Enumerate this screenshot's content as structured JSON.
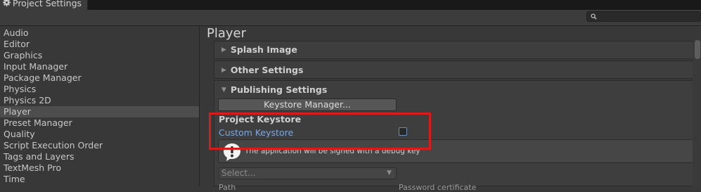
{
  "window": {
    "title": "Project Settings"
  },
  "search": {
    "placeholder": ""
  },
  "sidebar": {
    "items": [
      {
        "label": "Audio"
      },
      {
        "label": "Editor"
      },
      {
        "label": "Graphics"
      },
      {
        "label": "Input Manager"
      },
      {
        "label": "Package Manager"
      },
      {
        "label": "Physics"
      },
      {
        "label": "Physics 2D"
      },
      {
        "label": "Player"
      },
      {
        "label": "Preset Manager"
      },
      {
        "label": "Quality"
      },
      {
        "label": "Script Execution Order"
      },
      {
        "label": "Tags and Layers"
      },
      {
        "label": "TextMesh Pro"
      },
      {
        "label": "Time"
      }
    ],
    "selected": "Player"
  },
  "main": {
    "title": "Player",
    "foldouts": [
      {
        "label": "Splash Image",
        "expanded": false
      },
      {
        "label": "Other Settings",
        "expanded": false
      },
      {
        "label": "Publishing Settings",
        "expanded": true
      }
    ],
    "keystore_manager_button": "Keystore Manager...",
    "project_keystore_label": "Project Keystore",
    "custom_keystore_label": "Custom Keystore",
    "custom_keystore_checked": false,
    "help_message": "The application will be signed with a debug key",
    "select_placeholder": "Select...",
    "partial_row": {
      "left": "Path",
      "right": "Password certificate"
    }
  },
  "colors": {
    "highlight_border": "#d81c1c",
    "link_label": "#7ea7de",
    "selected_item": "#4d4d4d"
  },
  "icons": {
    "tab": "gear-icon",
    "search": "search-icon",
    "help": "warning-icon",
    "foldout_closed": "triangle-right-icon",
    "foldout_open": "triangle-down-icon"
  }
}
